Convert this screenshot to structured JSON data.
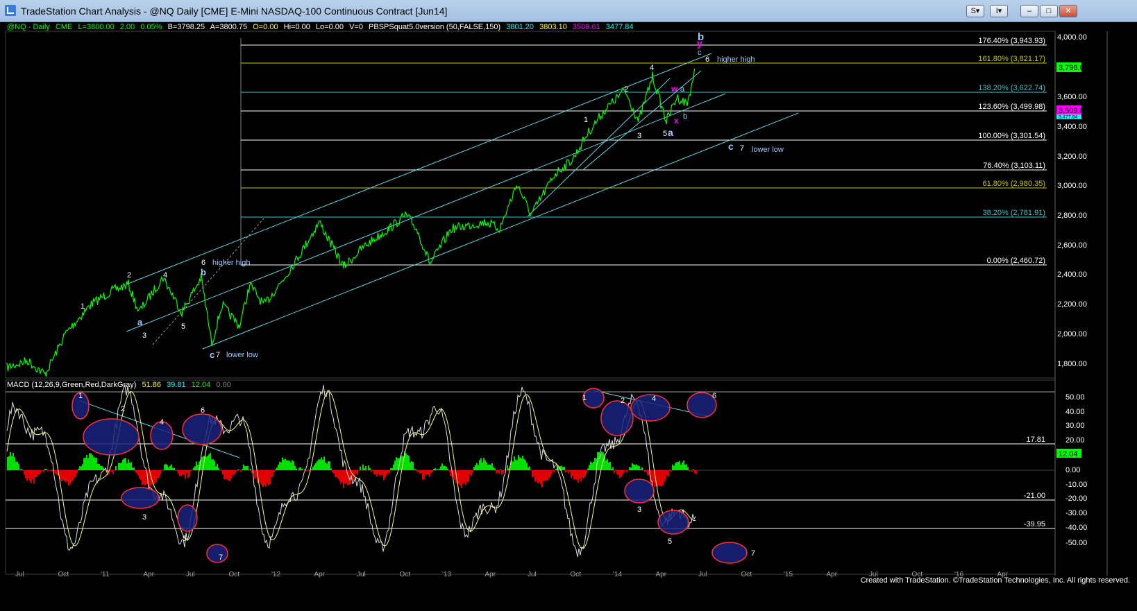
{
  "window": {
    "title": "TradeStation Chart Analysis - @NQ Daily [CME] E-Mini NASDAQ-100 Continuous Contract [Jun14]",
    "btn_s": "S",
    "btn_i": "I"
  },
  "status": {
    "symbol": "@NQ - Daily",
    "exchange": "CME",
    "last": "L=3800.00",
    "change": "2.00",
    "pct": "0.05%",
    "bid": "B=3798.25",
    "ask": "A=3800.75",
    "open": "O=0.00",
    "hi": "Hi=0.00",
    "lo": "Lo=0.00",
    "vol": "V=0",
    "study": "PBSPSquat5.0version (50,FALSE,150)",
    "v1": "3801.20",
    "v2": "3803.10",
    "v3": "3509.61",
    "v4": "3477.84",
    "colors": {
      "green": "#00ff00",
      "yellow": "#ffff00",
      "cyan": "#00ffff",
      "magenta": "#ff00ff"
    }
  },
  "price_axis": {
    "labels": [
      "4,000.00",
      "3,800.00",
      "3,600.00",
      "3,400.00",
      "3,200.00",
      "3,000.00",
      "2,800.00",
      "2,600.00",
      "2,400.00",
      "2,200.00",
      "2,000.00",
      "1,800.00"
    ],
    "current_price": "3,798.00",
    "marker_magenta": "3,509.61",
    "marker_cyan": "3,477.84"
  },
  "fib_levels": [
    {
      "label": "176.40% (3,943.93)",
      "color": "#ffffff"
    },
    {
      "label": "161.80% (3,821.17)",
      "color": "#c8c800"
    },
    {
      "label": "138.20% (3,622.74)",
      "color": "#40c0c0"
    },
    {
      "label": "123.60% (3,499.98)",
      "color": "#ffffff"
    },
    {
      "label": "100.00% (3,301.54)",
      "color": "#ffffff"
    },
    {
      "label": "76.40% (3,103.11)",
      "color": "#ffffff"
    },
    {
      "label": "61.80% (2,980.35)",
      "color": "#c8c800"
    },
    {
      "label": "38.20% (2,781.91)",
      "color": "#40c0c0"
    },
    {
      "label": "0.00% (2,460.72)",
      "color": "#ffffff"
    }
  ],
  "wave_labels": [
    {
      "text": "1",
      "color": "#ffffff"
    },
    {
      "text": "2",
      "color": "#ffffff"
    },
    {
      "text": "a",
      "color": "#9ecbff"
    },
    {
      "text": "3",
      "color": "#ffffff"
    },
    {
      "text": "4",
      "color": "#ffffff"
    },
    {
      "text": "5",
      "color": "#ffffff"
    },
    {
      "text": "6",
      "color": "#ffffff"
    },
    {
      "text": "b",
      "color": "#9ecbff"
    },
    {
      "text": "higher high",
      "color": "#9ecbff"
    },
    {
      "text": "c",
      "color": "#9ecbff"
    },
    {
      "text": "7",
      "color": "#ffffff"
    },
    {
      "text": "lower low",
      "color": "#9ecbff"
    },
    {
      "text": "1",
      "color": "#ffffff"
    },
    {
      "text": "2",
      "color": "#ffffff"
    },
    {
      "text": "3",
      "color": "#ffffff"
    },
    {
      "text": "4",
      "color": "#ffffff"
    },
    {
      "text": "5",
      "color": "#ffffff"
    },
    {
      "text": "a",
      "color": "#9ecbff"
    },
    {
      "text": "w",
      "color": "#ff00ff"
    },
    {
      "text": "a",
      "color": "#9ecbff"
    },
    {
      "text": "b",
      "color": "#9ecbff"
    },
    {
      "text": "x",
      "color": "#ff00ff"
    },
    {
      "text": "b",
      "color": "#9ecbff"
    },
    {
      "text": "y",
      "color": "#ff00ff"
    },
    {
      "text": "c",
      "color": "#9ecbff"
    },
    {
      "text": "6",
      "color": "#ffffff"
    },
    {
      "text": "higher high",
      "color": "#9ecbff"
    },
    {
      "text": "c",
      "color": "#9ecbff"
    },
    {
      "text": "7",
      "color": "#ffffff"
    },
    {
      "text": "lower low",
      "color": "#9ecbff"
    }
  ],
  "macd": {
    "title": "MACD (12,26,9,Green,Red,DarkGray)",
    "v1": "51.86",
    "v2": "39.81",
    "v3": "12.04",
    "v4": "0.00",
    "axis_labels": [
      "50.00",
      "40.00",
      "30.00",
      "20.00",
      "10.00",
      "0.00",
      "-10.00",
      "-20.00",
      "-30.00",
      "-40.00",
      "-50.00"
    ],
    "level_upper": "17.81",
    "level_current": "12.04",
    "level_lower1": "-21.00",
    "level_lower2": "-39.95",
    "wave_labels": [
      "1",
      "2",
      "3",
      "4",
      "5",
      "6",
      "7",
      "1",
      "2",
      "3",
      "4",
      "5",
      "6",
      "7"
    ]
  },
  "time_axis": [
    "Jul",
    "Oct",
    "'11",
    "Apr",
    "Jul",
    "Oct",
    "'12",
    "Apr",
    "Jul",
    "Oct",
    "'13",
    "Apr",
    "Jul",
    "Oct",
    "'14",
    "Apr",
    "Jul",
    "Oct",
    "'15",
    "Apr",
    "Jul",
    "Oct",
    "'16",
    "Apr"
  ],
  "credit": "Created with TradeStation. ©TradeStation Technologies, Inc. All rights reserved."
}
